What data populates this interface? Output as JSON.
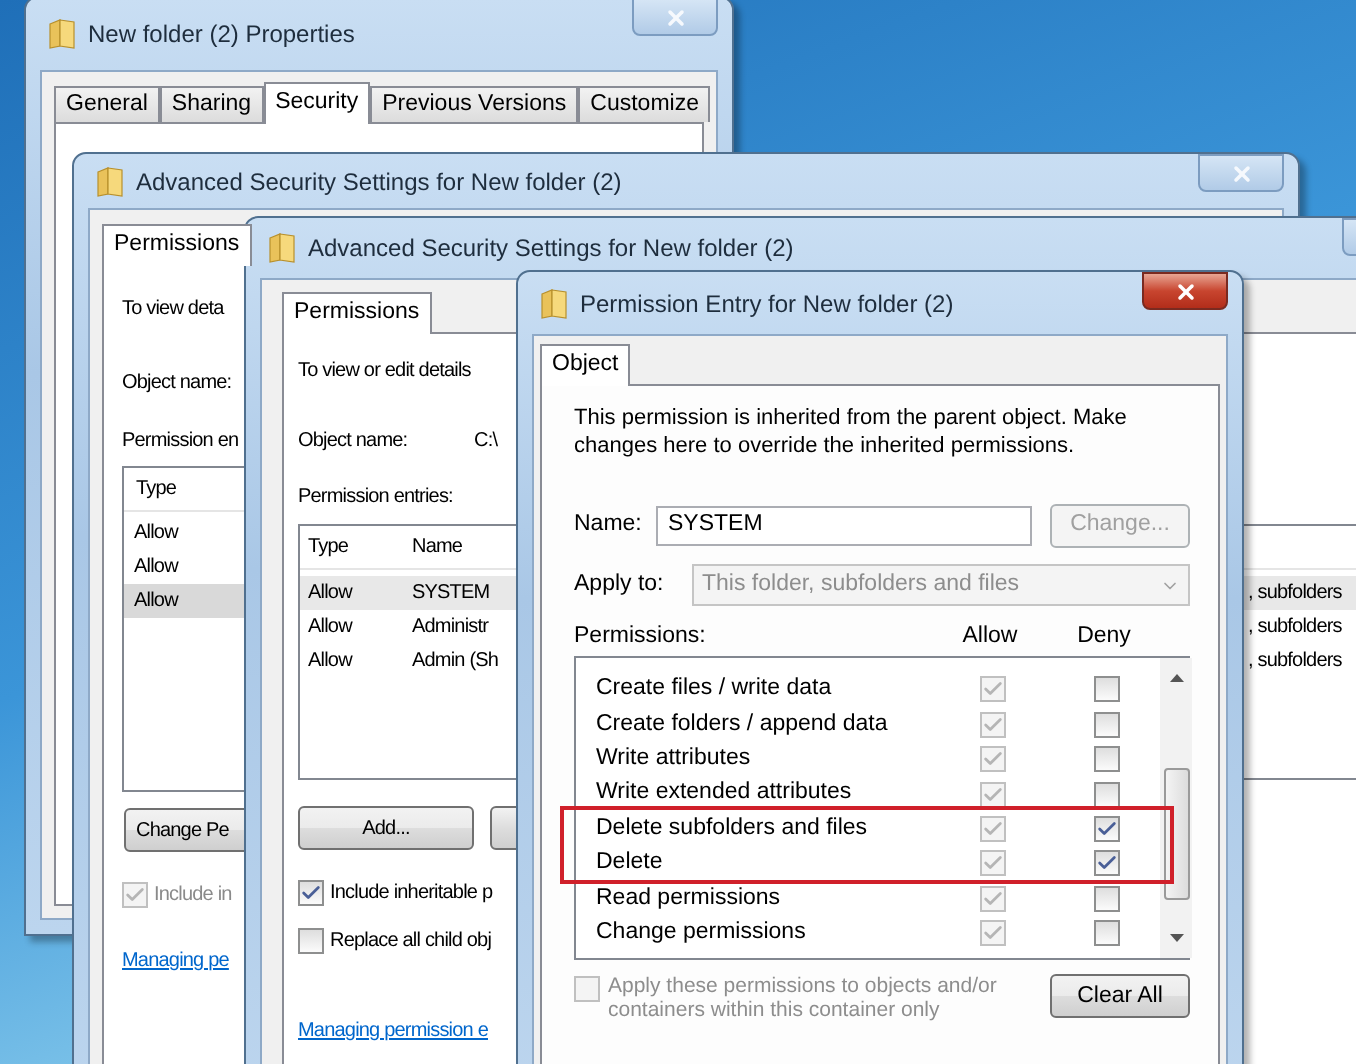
{
  "properties_window": {
    "title": "New folder (2) Properties",
    "active": false,
    "tabs": [
      {
        "label": "General",
        "selected": false
      },
      {
        "label": "Sharing",
        "selected": false
      },
      {
        "label": "Security",
        "selected": true
      },
      {
        "label": "Previous Versions",
        "selected": false
      },
      {
        "label": "Customize",
        "selected": false
      }
    ]
  },
  "advanced_window_back": {
    "title": "Advanced Security Settings for New folder (2)",
    "active": false,
    "tabs": [
      {
        "label": "Permissions",
        "selected": true
      }
    ],
    "intro": "To view deta",
    "object_label": "Object name:",
    "entries_label": "Permission en",
    "columns": [
      "Type"
    ],
    "rows": [
      {
        "type": "Allow",
        "selected": false
      },
      {
        "type": "Allow",
        "selected": false
      },
      {
        "type": "Allow",
        "selected": true
      }
    ],
    "button": "Change Pe",
    "checkbox": {
      "label": "Include in",
      "checked": true,
      "disabled": true
    },
    "link": "Managing pe"
  },
  "advanced_window_front": {
    "title": "Advanced Security Settings for New folder (2)",
    "active": false,
    "tabs": [
      {
        "label": "Permissions",
        "selected": true
      }
    ],
    "intro": "To view or edit details",
    "object_label": "Object name:",
    "object_value": "C:\\",
    "entries_label": "Permission entries:",
    "columns": [
      "Type",
      "Name"
    ],
    "rows": [
      {
        "type": "Allow",
        "name": "SYSTEM",
        "apply_to": ", subfolders",
        "selected": true
      },
      {
        "type": "Allow",
        "name": "Administr",
        "apply_to": ", subfolders",
        "selected": false
      },
      {
        "type": "Allow",
        "name": "Admin (Sh",
        "apply_to": ", subfolders",
        "selected": false
      }
    ],
    "add_button": "Add...",
    "checkboxes": [
      {
        "label": "Include inheritable p",
        "checked": true
      },
      {
        "label": "Replace all child obj",
        "checked": false
      }
    ],
    "link": "Managing permission e"
  },
  "permission_entry_window": {
    "title": "Permission Entry for New folder (2)",
    "active": true,
    "tabs": [
      {
        "label": "Object",
        "selected": true
      }
    ],
    "info": "This permission is inherited from the parent object. Make changes here to override the inherited permissions.",
    "name_label": "Name:",
    "name_value": "SYSTEM",
    "change_button": {
      "label": "Change...",
      "disabled": true
    },
    "apply_label": "Apply to:",
    "apply_value": "This folder, subfolders and files",
    "permissions_label": "Permissions:",
    "allow_header": "Allow",
    "deny_header": "Deny",
    "permissions": [
      {
        "name": "Create files / write data",
        "allow": true,
        "deny": false,
        "highlighted": false
      },
      {
        "name": "Create folders / append data",
        "allow": true,
        "deny": false,
        "highlighted": false
      },
      {
        "name": "Write attributes",
        "allow": true,
        "deny": false,
        "highlighted": false
      },
      {
        "name": "Write extended attributes",
        "allow": true,
        "deny": false,
        "highlighted": false
      },
      {
        "name": "Delete subfolders and files",
        "allow": true,
        "deny": true,
        "highlighted": true
      },
      {
        "name": "Delete",
        "allow": true,
        "deny": true,
        "highlighted": true
      },
      {
        "name": "Read permissions",
        "allow": true,
        "deny": false,
        "highlighted": false
      },
      {
        "name": "Change permissions",
        "allow": true,
        "deny": false,
        "highlighted": false
      }
    ],
    "apply_checkbox": {
      "label": "Apply these permissions to objects and/or containers within this container only",
      "checked": false,
      "disabled": true
    },
    "clear_button": "Clear All"
  }
}
